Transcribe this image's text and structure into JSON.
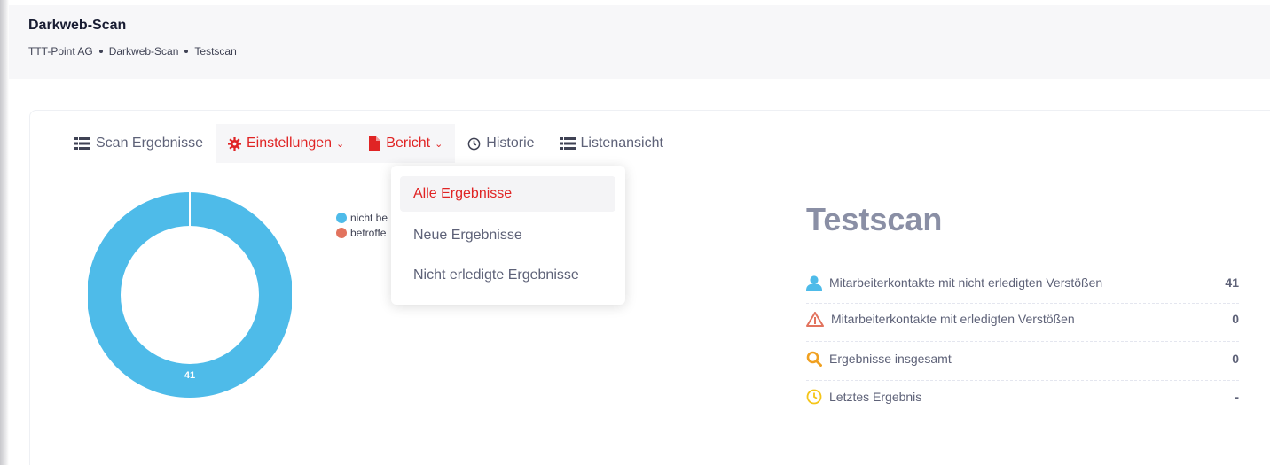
{
  "header": {
    "title": "Darkweb-Scan",
    "breadcrumb": [
      "TTT-Point AG",
      "Darkweb-Scan",
      "Testscan"
    ]
  },
  "tabs": [
    {
      "label": "Scan Ergebnisse",
      "icon": "list-icon"
    },
    {
      "label": "Einstellungen",
      "icon": "gear-icon"
    },
    {
      "label": "Bericht",
      "icon": "document-icon"
    },
    {
      "label": "Historie",
      "icon": "clock-icon"
    },
    {
      "label": "Listenansicht",
      "icon": "list-icon"
    }
  ],
  "report_menu": {
    "items": [
      "Alle Ergebnisse",
      "Neue Ergebnisse",
      "Nicht erledigte Ergebnisse"
    ],
    "active": "Alle Ergebnisse"
  },
  "chart": {
    "center_label": "41",
    "legend": [
      {
        "label": "nicht be",
        "color": "#4ebbe9"
      },
      {
        "label": "betroffe",
        "color": "#e2735e"
      }
    ]
  },
  "chart_data": {
    "type": "pie",
    "categories": [
      "nicht be",
      "betroffe"
    ],
    "values": [
      41,
      0
    ],
    "colors": [
      "#4ebbe9",
      "#e2735e"
    ]
  },
  "stats": {
    "title": "Testscan",
    "rows": [
      {
        "label": "Mitarbeiterkontakte mit nicht erledigten Verstößen",
        "value": "41",
        "icon": "user-icon",
        "icon_color": "#4ebbe9"
      },
      {
        "label": "Mitarbeiterkontakte mit erledigten Verstößen",
        "value": "0",
        "icon": "warning-icon",
        "icon_color": "#e2735e"
      },
      {
        "label": "Ergebnisse insgesamt",
        "value": "0",
        "icon": "search-icon",
        "icon_color": "#f0a020"
      },
      {
        "label": "Letztes Ergebnis",
        "value": "-",
        "icon": "clock-icon",
        "icon_color": "#f5c518"
      }
    ]
  },
  "colors": {
    "accent_red": "#e02424",
    "donut_blue": "#4ebbe9"
  }
}
